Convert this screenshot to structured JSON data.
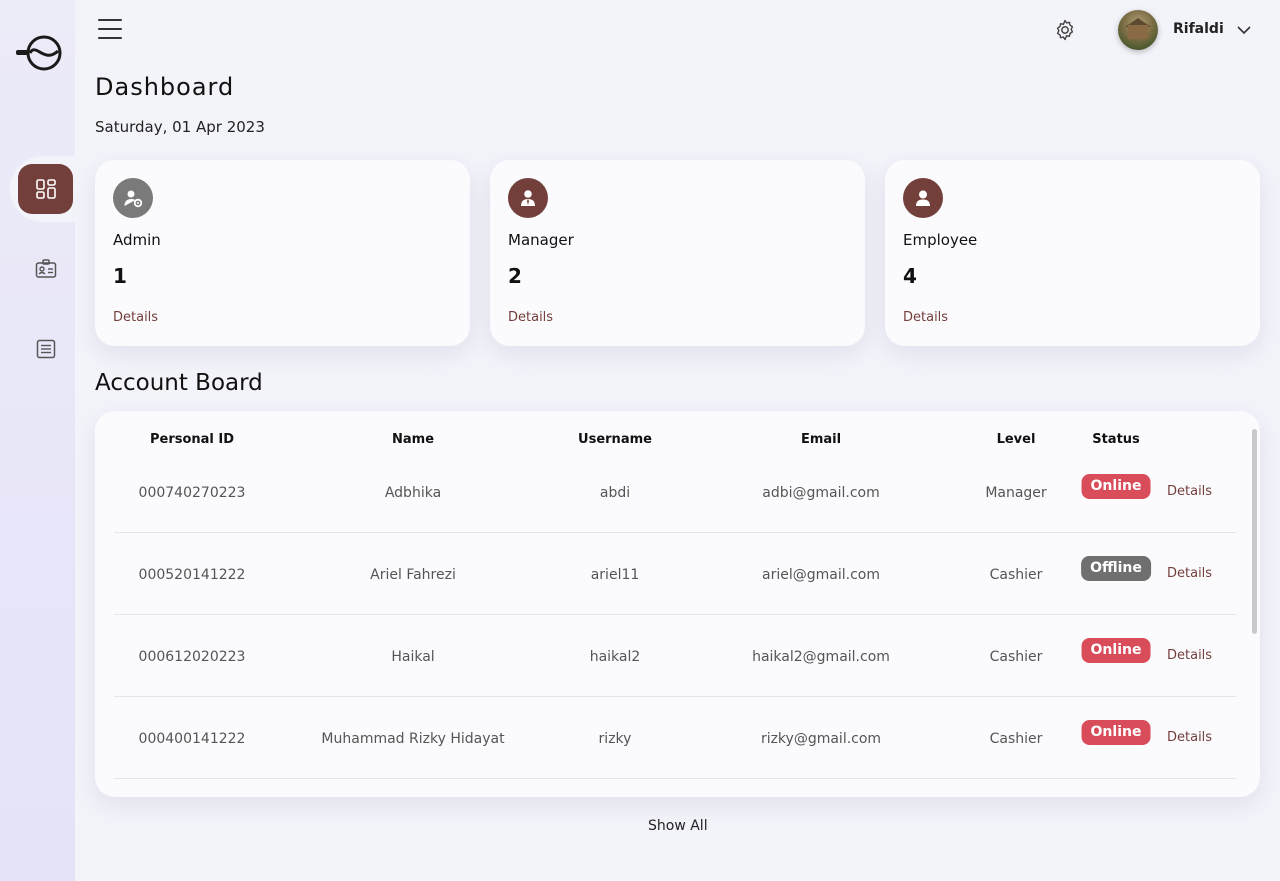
{
  "header": {
    "user_name": "Rifaldi"
  },
  "page": {
    "title": "Dashboard",
    "date": "Saturday, 01 Apr 2023"
  },
  "stats": [
    {
      "label": "Admin",
      "value": "1",
      "link": "Details",
      "icon": "admin-gear-icon",
      "color": "#7a7a7a"
    },
    {
      "label": "Manager",
      "value": "2",
      "link": "Details",
      "icon": "manager-icon",
      "color": "#733f3b"
    },
    {
      "label": "Employee",
      "value": "4",
      "link": "Details",
      "icon": "employee-icon",
      "color": "#733f3b"
    }
  ],
  "account_board": {
    "title": "Account Board",
    "columns": [
      "Personal ID",
      "Name",
      "Username",
      "Email",
      "Level",
      "Status"
    ],
    "rows": [
      {
        "id": "000740270223",
        "name": "Adbhika",
        "username": "abdi",
        "email": "adbi@gmail.com",
        "level": "Manager",
        "status": "Online",
        "link": "Details"
      },
      {
        "id": "000520141222",
        "name": "Ariel Fahrezi",
        "username": "ariel11",
        "email": "ariel@gmail.com",
        "level": "Cashier",
        "status": "Offline",
        "link": "Details"
      },
      {
        "id": "000612020223",
        "name": "Haikal",
        "username": "haikal2",
        "email": "haikal2@gmail.com",
        "level": "Cashier",
        "status": "Online",
        "link": "Details"
      },
      {
        "id": "000400141222",
        "name": "Muhammad Rizky Hidayat",
        "username": "rizky",
        "email": "rizky@gmail.com",
        "level": "Cashier",
        "status": "Online",
        "link": "Details"
      }
    ],
    "show_all": "Show All"
  },
  "colors": {
    "accent": "#733f3b",
    "online": "#d94c5a",
    "offline": "#6f6f6f"
  }
}
